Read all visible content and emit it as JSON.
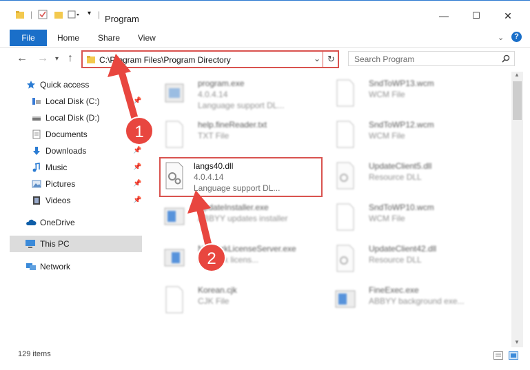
{
  "window": {
    "title": "Program"
  },
  "ribbon": {
    "file": "File",
    "tabs": [
      "Home",
      "Share",
      "View"
    ]
  },
  "address": {
    "path": "C:\\Program Files\\Program Directory"
  },
  "search": {
    "placeholder": "Search Program"
  },
  "sidebar": {
    "items": [
      {
        "label": "Quick access",
        "icon": "star-icon"
      },
      {
        "label": "Local Disk (C:)",
        "icon": "drive-icon"
      },
      {
        "label": "Local Disk (D:)",
        "icon": "drive-icon"
      },
      {
        "label": "Documents",
        "icon": "documents-icon"
      },
      {
        "label": "Downloads",
        "icon": "download-icon"
      },
      {
        "label": "Music",
        "icon": "music-icon"
      },
      {
        "label": "Pictures",
        "icon": "pictures-icon"
      },
      {
        "label": "Videos",
        "icon": "videos-icon"
      },
      {
        "label": "OneDrive",
        "icon": "cloud-icon"
      },
      {
        "label": "This PC",
        "icon": "computer-icon"
      },
      {
        "label": "Network",
        "icon": "network-icon"
      }
    ]
  },
  "files": [
    {
      "name": "program.exe",
      "line2": "4.0.4.14",
      "line3": "Language support DL..."
    },
    {
      "name": "SndToWP13.wcm",
      "line2": "WCM File",
      "line3": ""
    },
    {
      "name": "help.fineReader.txt",
      "line2": "TXT File",
      "line3": ""
    },
    {
      "name": "SndToWP12.wcm",
      "line2": "WCM File",
      "line3": ""
    },
    {
      "name": "langs40.dll",
      "line2": "4.0.4.14",
      "line3": "Language support DL..."
    },
    {
      "name": "UpdateClient5.dll",
      "line2": "Resource DLL",
      "line3": ""
    },
    {
      "name": "UpdateInstaller.exe",
      "line2": "ABBYY updates installer",
      "line3": ""
    },
    {
      "name": "SndToWP10.wcm",
      "line2": "WCM File",
      "line3": ""
    },
    {
      "name": "NetworkLicenseServer.exe",
      "line2": "Network licens...",
      "line3": ""
    },
    {
      "name": "UpdateClient42.dll",
      "line2": "Resource DLL",
      "line3": ""
    },
    {
      "name": "Korean.cjk",
      "line2": "CJK File",
      "line3": ""
    },
    {
      "name": "FineExec.exe",
      "line2": "ABBYY background exe...",
      "line3": ""
    }
  ],
  "annotations": {
    "step1": "1",
    "step2": "2"
  },
  "status": {
    "count": "129 items"
  },
  "colors": {
    "accent": "#1a6fc9",
    "highlight": "#d9534f"
  }
}
